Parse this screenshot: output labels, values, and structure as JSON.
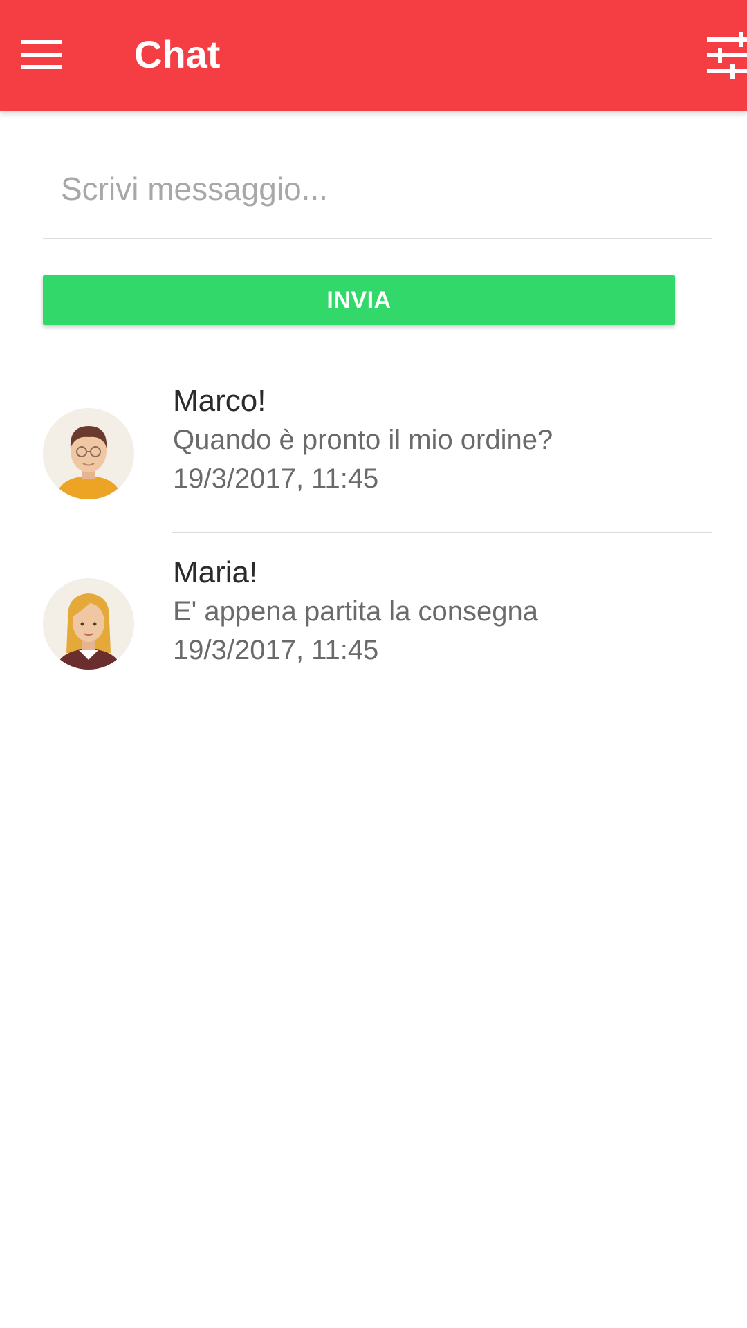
{
  "colors": {
    "appbar": "#F43E43",
    "send_button": "#32D96A",
    "background": "#FFFFFF"
  },
  "header": {
    "title": "Chat",
    "menu_icon": "hamburger-menu-icon",
    "filter_icon": "sliders-icon"
  },
  "composer": {
    "placeholder": "Scrivi messaggio...",
    "value": "",
    "send_label": "INVIA"
  },
  "messages": [
    {
      "sender": "Marco!",
      "text": "Quando è pronto il mio ordine?",
      "timestamp": "19/3/2017, 11:45",
      "avatar_icon": "male-avatar-icon"
    },
    {
      "sender": "Maria!",
      "text": "E' appena partita la consegna",
      "timestamp": "19/3/2017, 11:45",
      "avatar_icon": "female-avatar-icon"
    }
  ]
}
